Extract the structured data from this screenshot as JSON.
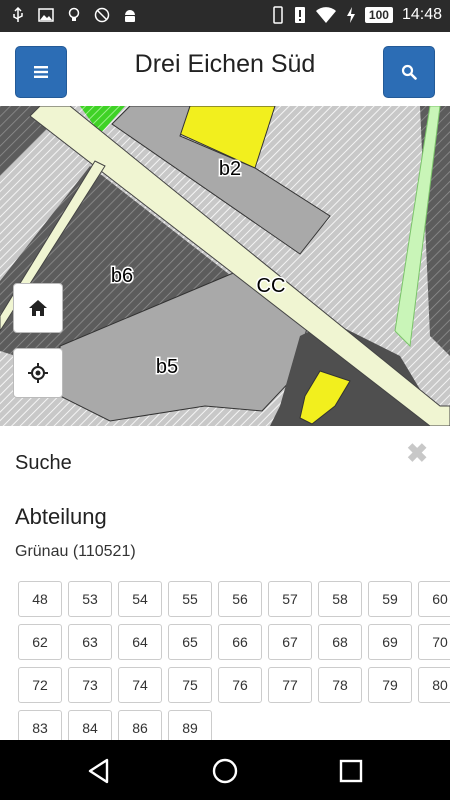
{
  "status_bar": {
    "battery": "100",
    "time": "14:48"
  },
  "app_bar": {
    "title": "Drei Eichen Süd",
    "menu_icon": "menu-icon",
    "search_icon": "search-icon"
  },
  "map": {
    "labels": {
      "b2": "b2",
      "b6": "b6",
      "cc": "CC",
      "b5": "b5"
    },
    "controls": {
      "home_icon": "home-icon",
      "locate_icon": "crosshair-icon"
    }
  },
  "panel": {
    "close": "✖",
    "heading": "Suche",
    "section": "Abteilung",
    "region": "Grünau (110521)",
    "rows": [
      [
        "48",
        "53",
        "54",
        "55",
        "56",
        "57",
        "58",
        "59",
        "60"
      ],
      [
        "62",
        "63",
        "64",
        "65",
        "66",
        "67",
        "68",
        "69",
        "70"
      ],
      [
        "72",
        "73",
        "74",
        "75",
        "76",
        "77",
        "78",
        "79",
        "80"
      ],
      [
        "83",
        "84",
        "86",
        "89"
      ]
    ]
  },
  "colors": {
    "accent": "#2c6db5",
    "status_bar": "#2b2b2b",
    "nav_bar": "#000000",
    "parcel_yellow": "#f2ef1e",
    "road": "#f0f5d2",
    "green": "#4dde2a"
  }
}
